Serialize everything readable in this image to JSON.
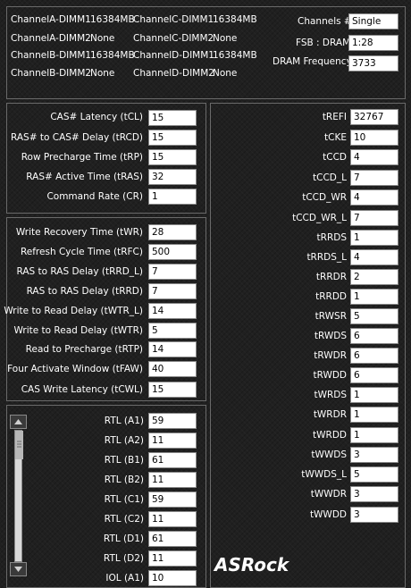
{
  "dimms": [
    {
      "label": "ChannelA-DIMM1",
      "value": "16384MB"
    },
    {
      "label": "ChannelA-DIMM2",
      "value": "None"
    },
    {
      "label": "ChannelB-DIMM1",
      "value": "16384MB"
    },
    {
      "label": "ChannelB-DIMM2",
      "value": "None"
    },
    {
      "label": "ChannelC-DIMM1",
      "value": "16384MB"
    },
    {
      "label": "ChannelC-DIMM2",
      "value": "None"
    },
    {
      "label": "ChannelD-DIMM1",
      "value": "16384MB"
    },
    {
      "label": "ChannelD-DIMM2",
      "value": "None"
    }
  ],
  "info": [
    {
      "label": "Channels #",
      "value": "Single"
    },
    {
      "label": "FSB : DRAM",
      "value": "1:28"
    },
    {
      "label": "DRAM Frequency",
      "value": "3733"
    }
  ],
  "primary": [
    {
      "label": "CAS# Latency (tCL)",
      "value": "15"
    },
    {
      "label": "RAS# to CAS# Delay (tRCD)",
      "value": "15"
    },
    {
      "label": "Row Precharge Time (tRP)",
      "value": "15"
    },
    {
      "label": "RAS# Active Time (tRAS)",
      "value": "32"
    },
    {
      "label": "Command Rate (CR)",
      "value": "1"
    }
  ],
  "secondary": [
    {
      "label": "Write Recovery Time (tWR)",
      "value": "28"
    },
    {
      "label": "Refresh Cycle Time (tRFC)",
      "value": "500"
    },
    {
      "label": "RAS to RAS Delay (tRRD_L)",
      "value": "7"
    },
    {
      "label": "RAS to RAS Delay (tRRD)",
      "value": "7"
    },
    {
      "label": "Write to Read Delay (tWTR_L)",
      "value": "14"
    },
    {
      "label": "Write to Read Delay (tWTR)",
      "value": "5"
    },
    {
      "label": "Read to Precharge (tRTP)",
      "value": "14"
    },
    {
      "label": "Four Activate Window (tFAW)",
      "value": "40"
    },
    {
      "label": "CAS Write Latency (tCWL)",
      "value": "15"
    }
  ],
  "rtl": [
    {
      "label": "RTL (A1)",
      "value": "59"
    },
    {
      "label": "RTL (A2)",
      "value": "11"
    },
    {
      "label": "RTL (B1)",
      "value": "61"
    },
    {
      "label": "RTL (B2)",
      "value": "11"
    },
    {
      "label": "RTL (C1)",
      "value": "59"
    },
    {
      "label": "RTL (C2)",
      "value": "11"
    },
    {
      "label": "RTL (D1)",
      "value": "61"
    },
    {
      "label": "RTL (D2)",
      "value": "11"
    },
    {
      "label": "IOL (A1)",
      "value": "10"
    }
  ],
  "tertiary": [
    {
      "label": "tREFI",
      "value": "32767"
    },
    {
      "label": "tCKE",
      "value": "10"
    },
    {
      "label": "tCCD",
      "value": "4"
    },
    {
      "label": "tCCD_L",
      "value": "7"
    },
    {
      "label": "tCCD_WR",
      "value": "4"
    },
    {
      "label": "tCCD_WR_L",
      "value": "7"
    },
    {
      "label": "tRRDS",
      "value": "1"
    },
    {
      "label": "tRRDS_L",
      "value": "4"
    },
    {
      "label": "tRRDR",
      "value": "2"
    },
    {
      "label": "tRRDD",
      "value": "1"
    },
    {
      "label": "tRWSR",
      "value": "5"
    },
    {
      "label": "tRWDS",
      "value": "6"
    },
    {
      "label": "tRWDR",
      "value": "6"
    },
    {
      "label": "tRWDD",
      "value": "6"
    },
    {
      "label": "tWRDS",
      "value": "1"
    },
    {
      "label": "tWRDR",
      "value": "1"
    },
    {
      "label": "tWRDD",
      "value": "1"
    },
    {
      "label": "tWWDS",
      "value": "3"
    },
    {
      "label": "tWWDS_L",
      "value": "5"
    },
    {
      "label": "tWWDR",
      "value": "3"
    },
    {
      "label": "tWWDD",
      "value": "3"
    }
  ],
  "logo_text": "ASRock",
  "icons": {
    "scroll_up": "arrow-up-icon",
    "scroll_down": "arrow-down-icon"
  }
}
